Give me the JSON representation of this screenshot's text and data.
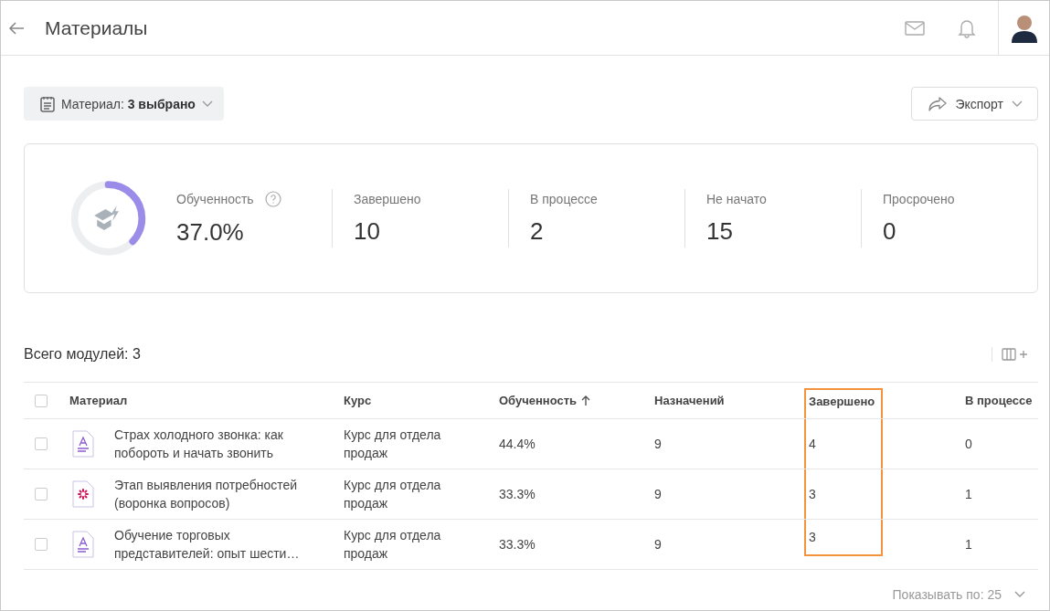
{
  "header": {
    "title": "Материалы"
  },
  "filter": {
    "label": "Материал:",
    "value": "3 выбрано"
  },
  "export_button": {
    "label": "Экспорт"
  },
  "summary": {
    "level": 0.37,
    "stats": [
      {
        "label": "Обученность",
        "value": "37.0%"
      },
      {
        "label": "Завершено",
        "value": "10"
      },
      {
        "label": "В процессе",
        "value": "2"
      },
      {
        "label": "Не начато",
        "value": "15"
      },
      {
        "label": "Просрочено",
        "value": "0"
      }
    ]
  },
  "table": {
    "total": "Всего модулей: 3",
    "header_checked": false,
    "columns": [
      {
        "label": "Материал",
        "sorted": false,
        "highlighted": false
      },
      {
        "label": "Курс",
        "sorted": false,
        "highlighted": false
      },
      {
        "label": "Обученность",
        "sorted": true,
        "highlighted": false
      },
      {
        "label": "Назначений",
        "sorted": false,
        "highlighted": false
      },
      {
        "label": "Завершено",
        "sorted": false,
        "highlighted": true
      },
      {
        "label": "В процессе",
        "sorted": false,
        "highlighted": false
      }
    ],
    "rows": [
      {
        "checked": false,
        "kind": "text",
        "cells": [
          "Страх холодного звонка: как побороть и начать звонить",
          "Курс для отдела продаж",
          "44.4%",
          "9",
          "4",
          "0"
        ]
      },
      {
        "checked": false,
        "kind": "interactive",
        "cells": [
          "Этап выявления потребностей (воронка вопросов)",
          "Курс для отдела продаж",
          "33.3%",
          "9",
          "3",
          "1"
        ]
      },
      {
        "checked": false,
        "kind": "text",
        "cells": [
          "Обучение торговых представителей: опыт шести…",
          "Курс для отдела продаж",
          "33.3%",
          "9",
          "3",
          "1"
        ]
      }
    ]
  },
  "pagination": {
    "label": "Показывать по: 25"
  }
}
